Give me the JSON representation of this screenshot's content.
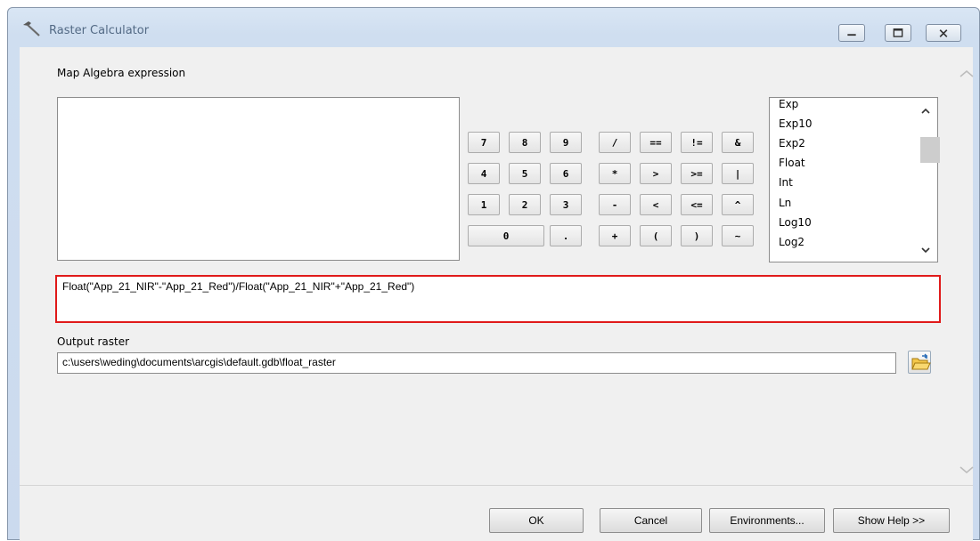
{
  "window": {
    "title": "Raster Calculator"
  },
  "expression_section": {
    "label": "Map Algebra expression"
  },
  "calculator": {
    "rows": [
      [
        "7",
        "8",
        "9",
        "/",
        "==",
        "!=",
        "&"
      ],
      [
        "4",
        "5",
        "6",
        "*",
        ">",
        ">=",
        "|"
      ],
      [
        "1",
        "2",
        "3",
        "-",
        "<",
        "<=",
        "^"
      ],
      [
        "0",
        ".",
        "+",
        "(",
        ")",
        "~"
      ]
    ]
  },
  "functions": {
    "items": [
      "Exp",
      "Exp10",
      "Exp2",
      "Float",
      "Int",
      "Ln",
      "Log10",
      "Log2"
    ]
  },
  "expression": {
    "value": "Float(\"App_21_NIR\"-\"App_21_Red\")/Float(\"App_21_NIR\"+\"App_21_Red\")"
  },
  "output": {
    "label": "Output raster",
    "value": "c:\\users\\weding\\documents\\arcgis\\default.gdb\\float_raster"
  },
  "buttons": {
    "ok": "OK",
    "cancel": "Cancel",
    "environments": "Environments...",
    "help": "Show Help >>"
  },
  "colors": {
    "highlight": "#e01a1a",
    "titlebar": "#d9e6f4"
  },
  "icons": {
    "window": "hammer-icon",
    "browse": "open-folder-icon"
  }
}
